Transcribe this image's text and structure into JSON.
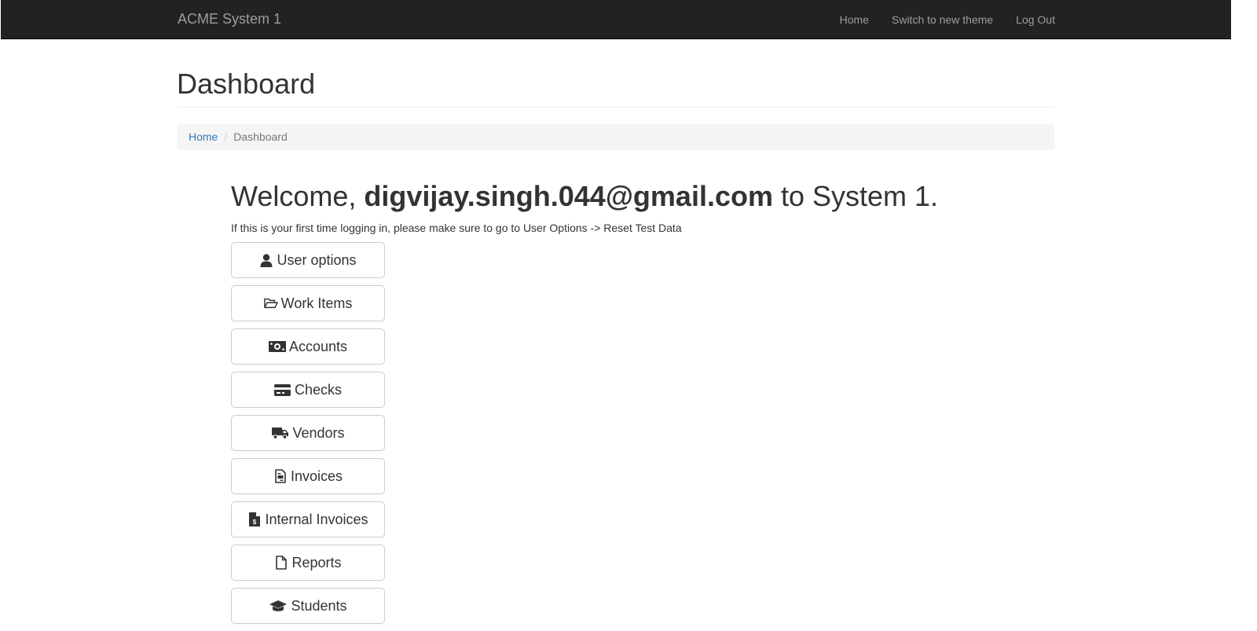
{
  "navbar": {
    "brand": "ACME System 1",
    "links": [
      "Home",
      "Switch to new theme",
      "Log Out"
    ]
  },
  "page": {
    "title": "Dashboard"
  },
  "breadcrumb": {
    "home": "Home",
    "separator": "/",
    "current": "Dashboard"
  },
  "welcome": {
    "prefix": "Welcome, ",
    "email": "digvijay.singh.044@gmail.com",
    "suffix": " to System 1.",
    "hint": "If this is your first time logging in, please make sure to go to User Options -> Reset Test Data"
  },
  "menu": [
    {
      "label": "User options",
      "icon": "user-icon"
    },
    {
      "label": "Work Items",
      "icon": "folder-open-icon"
    },
    {
      "label": "Accounts",
      "icon": "money-icon"
    },
    {
      "label": "Checks",
      "icon": "credit-card-icon"
    },
    {
      "label": "Vendors",
      "icon": "truck-icon"
    },
    {
      "label": "Invoices",
      "icon": "invoice-icon"
    },
    {
      "label": "Internal Invoices",
      "icon": "dollar-file-icon"
    },
    {
      "label": "Reports",
      "icon": "file-icon"
    },
    {
      "label": "Students",
      "icon": "graduation-cap-icon"
    }
  ],
  "colors": {
    "navbar_bg": "#222222",
    "navbar_text": "#9d9d9d",
    "link": "#337ab7",
    "breadcrumb_bg": "#f5f5f5"
  }
}
